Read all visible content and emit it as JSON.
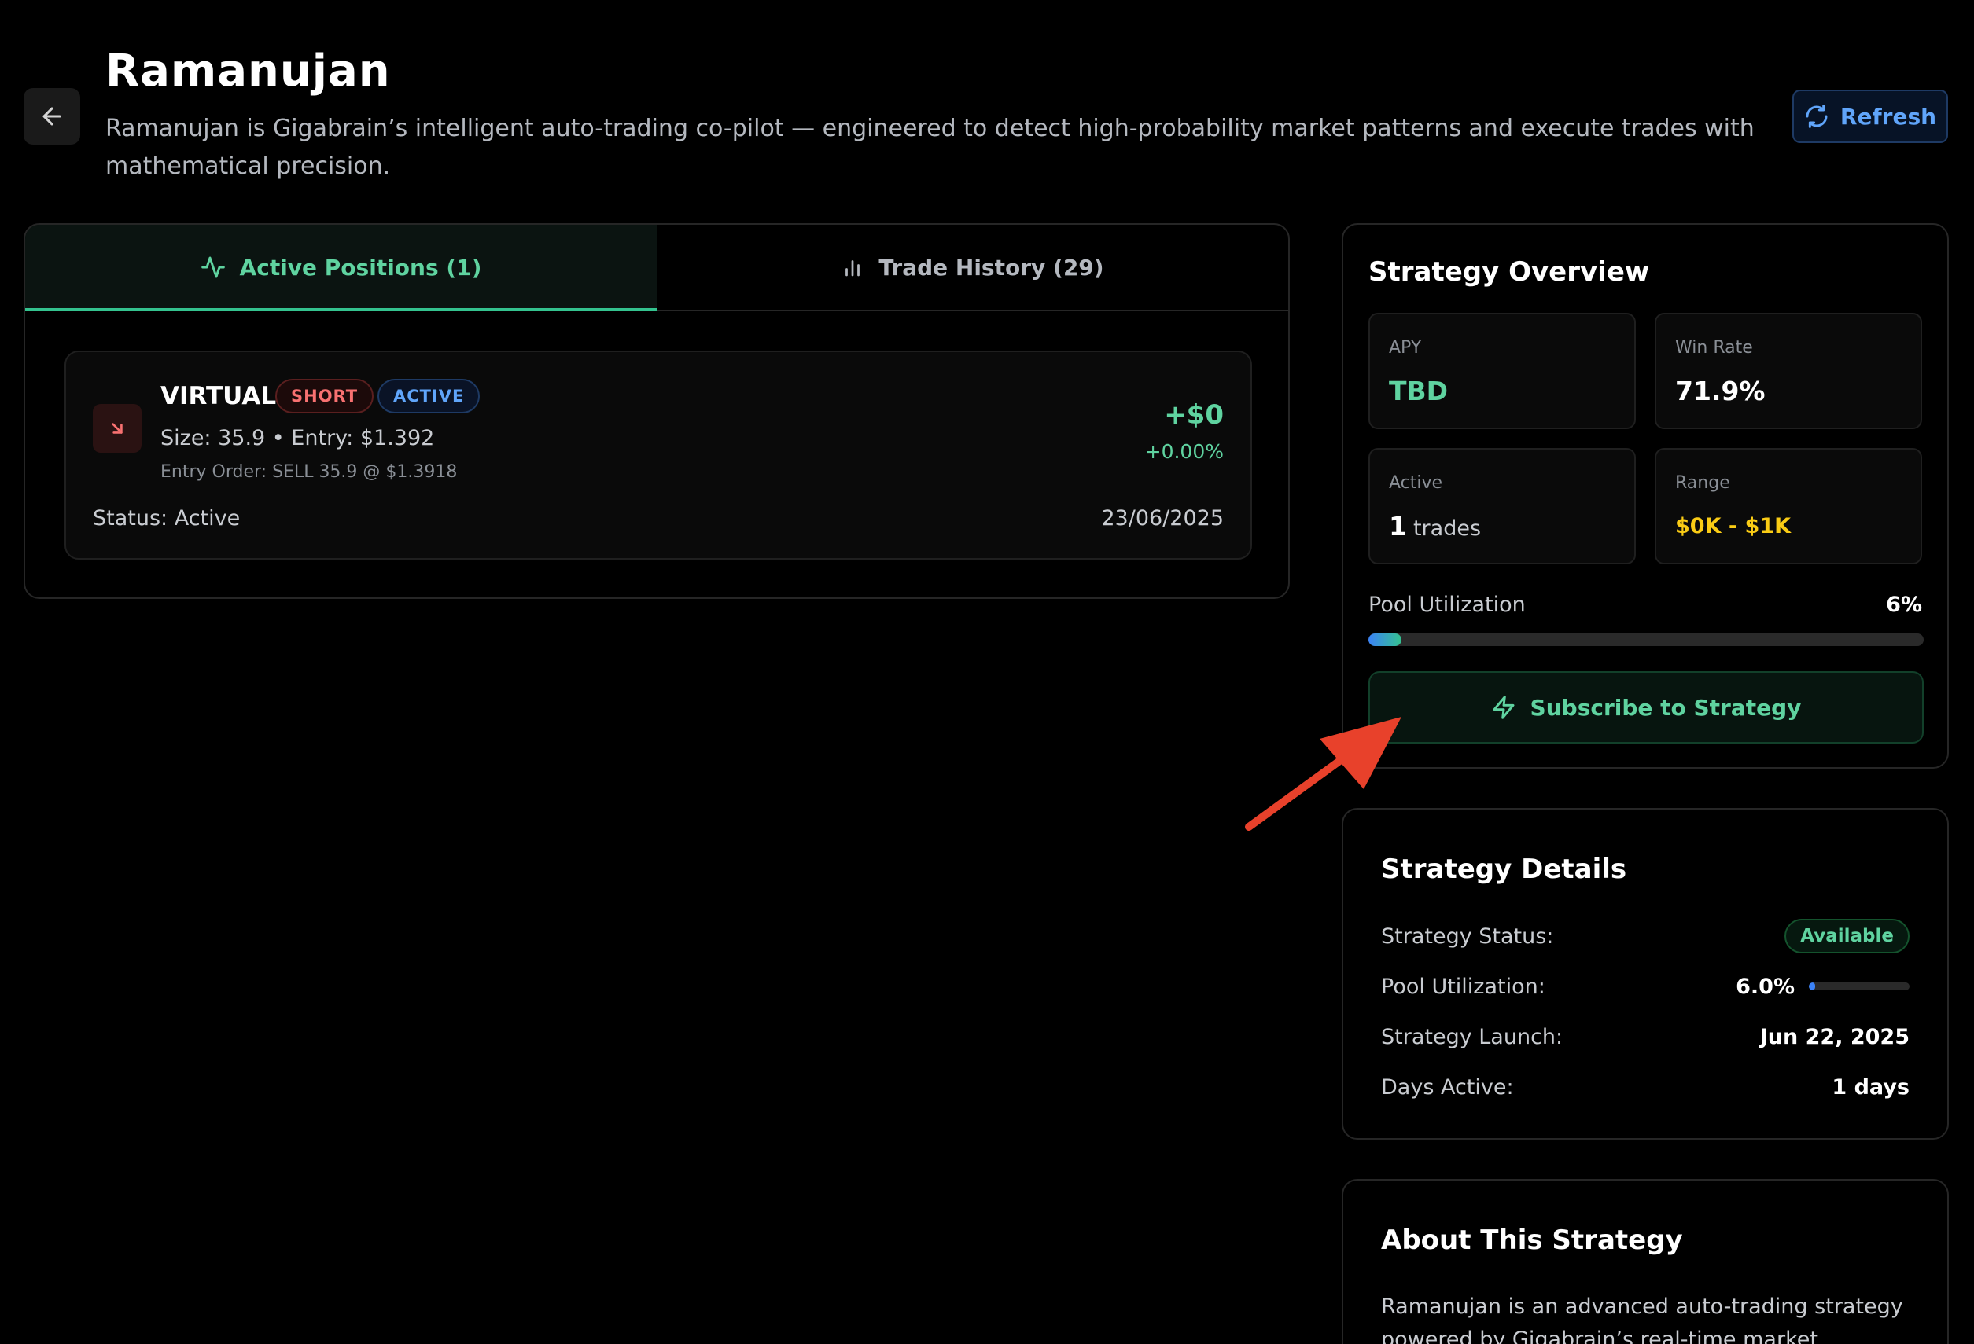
{
  "header": {
    "title": "Ramanujan",
    "description": "Ramanujan is Gigabrain’s intelligent auto-trading co-pilot — engineered to detect high-probability market patterns and execute trades with mathematical precision.",
    "refresh_label": "Refresh"
  },
  "tabs": [
    {
      "label": "Active Positions (1)",
      "icon": "activity-icon",
      "active": true
    },
    {
      "label": "Trade History (29)",
      "icon": "bar-chart-icon",
      "active": false
    }
  ],
  "position": {
    "symbol": "VIRTUAL",
    "side_badge": "SHORT",
    "state_badge": "ACTIVE",
    "size_entry": "Size: 35.9 • Entry: $1.392",
    "entry_order": "Entry Order: SELL 35.9 @ $1.3918",
    "pnl": "+$0",
    "pnl_pct": "+0.00%",
    "status": "Status: Active",
    "date": "23/06/2025"
  },
  "overview": {
    "title": "Strategy Overview",
    "apy_label": "APY",
    "apy_value": "TBD",
    "win_rate_label": "Win Rate",
    "win_rate_value": "71.9%",
    "active_label": "Active",
    "active_value": "1",
    "active_unit": "trades",
    "range_label": "Range",
    "range_value": "$0K - $1K",
    "pool_label": "Pool Utilization",
    "pool_pct": "6%",
    "pool_fraction": 0.06,
    "subscribe_label": "Subscribe to Strategy"
  },
  "details": {
    "title": "Strategy Details",
    "status_label": "Strategy Status:",
    "status_value": "Available",
    "pool_label": "Pool Utilization:",
    "pool_value": "6.0%",
    "pool_fraction": 0.06,
    "launch_label": "Strategy Launch:",
    "launch_value": "Jun 22, 2025",
    "days_label": "Days Active:",
    "days_value": "1 days"
  },
  "about": {
    "title": "About This Strategy",
    "text": "Ramanujan is an advanced auto-trading strategy powered by Gigabrain’s real-time market"
  },
  "colors": {
    "accent_green": "#5fd3a0",
    "accent_blue": "#60a5fa",
    "short_red": "#f87171",
    "range_yellow": "#facc15",
    "annotation_red": "#e8412b"
  }
}
